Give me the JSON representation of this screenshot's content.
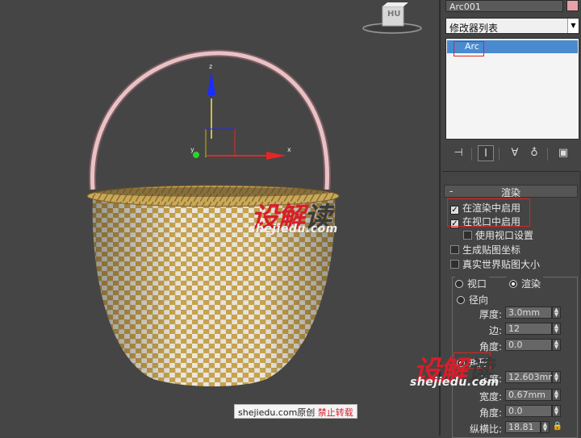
{
  "viewport": {
    "viewcube_label": "HU",
    "gizmo_axis_labels": {
      "z": "z",
      "x": "x",
      "y": "y"
    },
    "watermark_logo": {
      "red": "设解",
      "dark": "读"
    },
    "watermark_url": "shejiedu.com",
    "credit": {
      "site": "shejiedu.com",
      "original": "原创",
      "warning": "禁止转载"
    }
  },
  "panel": {
    "object_name": "Arc001",
    "object_color": "#e8a0a6",
    "modifier_list_label": "修改器列表",
    "stack_item": "Arc",
    "tools": [
      "pin-stack-icon",
      "show-end-result-icon",
      "make-unique-icon",
      "remove-modifier-icon",
      "configure-modifier-sets-icon"
    ],
    "rollout": {
      "title": "渲染",
      "enable_in_renderer": {
        "label": "在渲染中启用",
        "checked": true
      },
      "enable_in_viewport": {
        "label": "在视口中启用",
        "checked": true
      },
      "use_viewport_settings": {
        "label": "使用视口设置",
        "checked": false
      },
      "generate_mapping_coords": {
        "label": "生成贴图坐标",
        "checked": false
      },
      "real_world_map_size": {
        "label": "真实世界贴图大小",
        "checked": false
      },
      "viewport_radio": "视口",
      "render_radio": "渲染",
      "radial_radio": "径向",
      "thickness": {
        "label": "厚度:",
        "value": "3.0mm"
      },
      "sides": {
        "label": "边:",
        "value": "12"
      },
      "angle1": {
        "label": "角度:",
        "value": "0.0"
      },
      "rectangular_radio": "矩形",
      "length": {
        "label": "长度:",
        "value": "12.603mm"
      },
      "width": {
        "label": "宽度:",
        "value": "0.67mm"
      },
      "angle2": {
        "label": "角度:",
        "value": "0.0"
      },
      "aspect": {
        "label": "纵横比:",
        "value": "18.81"
      }
    }
  }
}
